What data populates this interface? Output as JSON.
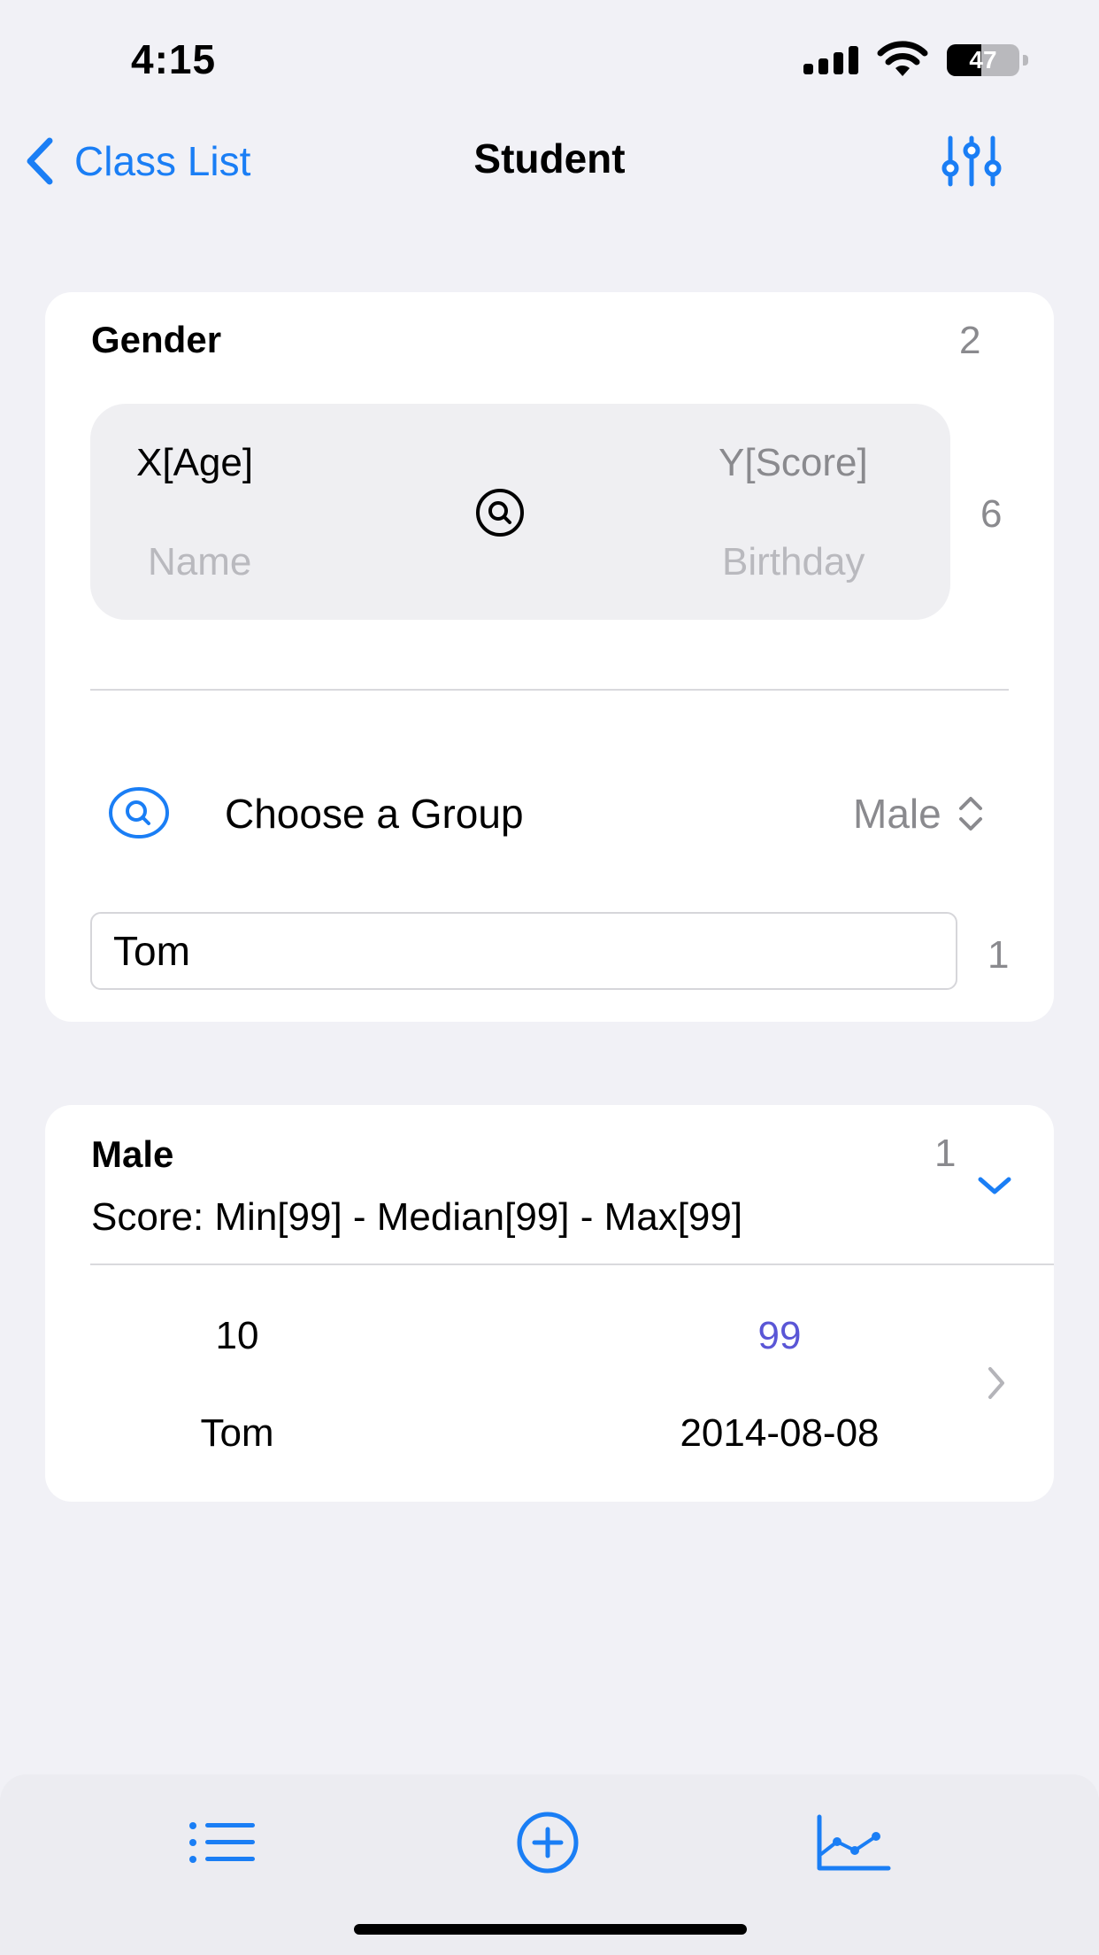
{
  "status_bar": {
    "time": "4:15",
    "battery": "47",
    "battery_level": 0.47
  },
  "nav": {
    "back_label": "Class List",
    "title": "Student"
  },
  "group_card": {
    "title": "Gender",
    "count": "2",
    "axes": {
      "x_label": "X[Age]",
      "y_label": "Y[Score]",
      "name_label": "Name",
      "birthday_label": "Birthday",
      "count": "6"
    },
    "choose_group_label": "Choose a Group",
    "selected_group": "Male",
    "search_value": "Tom",
    "search_count": "1"
  },
  "result_card": {
    "title": "Male",
    "count": "1",
    "summary": "Score: Min[99] - Median[99] - Max[99]",
    "rows": [
      {
        "age": "10",
        "score": "99",
        "name": "Tom",
        "birthday": "2014-08-08"
      }
    ]
  },
  "tab_bar": {
    "items": [
      "list-icon",
      "add-circle-icon",
      "line-chart-icon"
    ]
  },
  "colors": {
    "accent": "#1a7ef5",
    "score": "#5a56d6",
    "background": "#f1f1f6"
  }
}
